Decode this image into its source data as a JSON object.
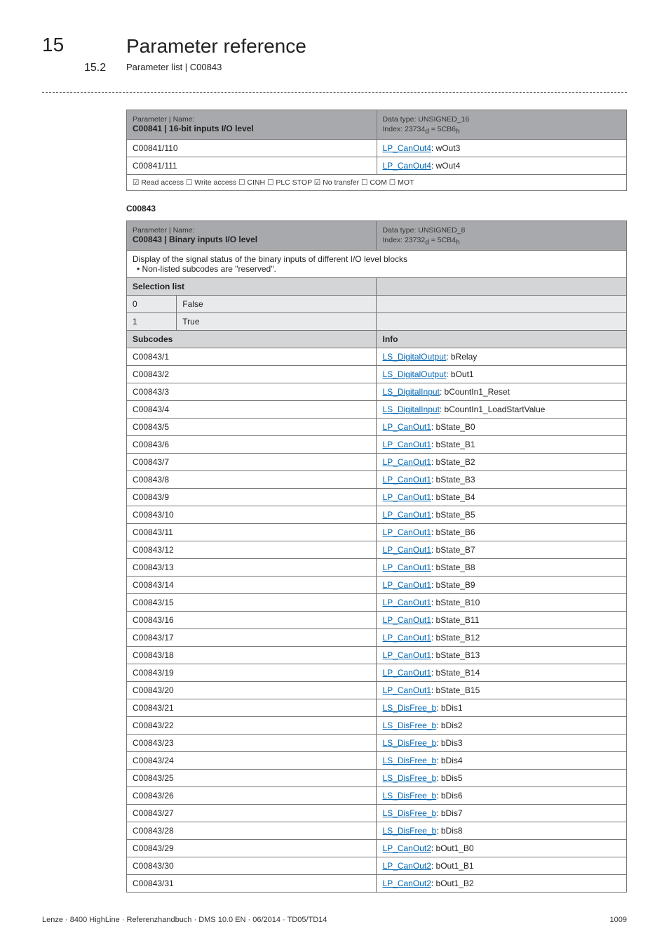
{
  "chapter": {
    "num": "15",
    "title": "Parameter reference"
  },
  "section": {
    "num": "15.2",
    "title": "Parameter list | C00843"
  },
  "table1": {
    "header_left": "Parameter | Name:",
    "header_code": "C00841 | 16-bit inputs I/O level",
    "header_right_l1": "Data type: UNSIGNED_16",
    "header_right_l2_a": "Index: 23734",
    "header_right_l2_sub": "d",
    "header_right_l2_b": " = 5CB6",
    "header_right_l2_sub2": "h",
    "rows": [
      {
        "code": "C00841/110",
        "link": "LP_CanOut4",
        "after": ": wOut3"
      },
      {
        "code": "C00841/111",
        "link": "LP_CanOut4",
        "after": ": wOut4"
      }
    ],
    "footer": "☑ Read access   ☐ Write access   ☐ CINH   ☐ PLC STOP   ☑ No transfer   ☐ COM   ☐ MOT"
  },
  "anchor": "C00843",
  "table2": {
    "header_left": "Parameter | Name:",
    "header_code": "C00843 | Binary inputs I/O level",
    "header_right_l1": "Data type: UNSIGNED_8",
    "header_right_l2_a": "Index: 23732",
    "header_right_l2_sub": "d",
    "header_right_l2_b": " = 5CB4",
    "header_right_l2_sub2": "h",
    "desc1": "Display of the signal status of the binary inputs of different I/O level blocks",
    "desc2": "• Non-listed subcodes are \"reserved\".",
    "selection_label": "Selection list",
    "sel_rows": [
      {
        "n": "0",
        "v": "False"
      },
      {
        "n": "1",
        "v": "True"
      }
    ],
    "subcodes_label": "Subcodes",
    "info_label": "Info",
    "rows": [
      {
        "code": "C00843/1",
        "link": "LS_DigitalOutput",
        "after": ": bRelay"
      },
      {
        "code": "C00843/2",
        "link": "LS_DigitalOutput",
        "after": ": bOut1"
      },
      {
        "code": "C00843/3",
        "link": "LS_DigitalInput",
        "after": ": bCountIn1_Reset"
      },
      {
        "code": "C00843/4",
        "link": "LS_DigitalInput",
        "after": ": bCountIn1_LoadStartValue"
      },
      {
        "code": "C00843/5",
        "link": "LP_CanOut1",
        "after": ": bState_B0"
      },
      {
        "code": "C00843/6",
        "link": "LP_CanOut1",
        "after": ": bState_B1"
      },
      {
        "code": "C00843/7",
        "link": "LP_CanOut1",
        "after": ": bState_B2"
      },
      {
        "code": "C00843/8",
        "link": "LP_CanOut1",
        "after": ": bState_B3"
      },
      {
        "code": "C00843/9",
        "link": "LP_CanOut1",
        "after": ": bState_B4"
      },
      {
        "code": "C00843/10",
        "link": "LP_CanOut1",
        "after": ": bState_B5"
      },
      {
        "code": "C00843/11",
        "link": "LP_CanOut1",
        "after": ": bState_B6"
      },
      {
        "code": "C00843/12",
        "link": "LP_CanOut1",
        "after": ": bState_B7"
      },
      {
        "code": "C00843/13",
        "link": "LP_CanOut1",
        "after": ": bState_B8"
      },
      {
        "code": "C00843/14",
        "link": "LP_CanOut1",
        "after": ": bState_B9"
      },
      {
        "code": "C00843/15",
        "link": "LP_CanOut1",
        "after": ": bState_B10"
      },
      {
        "code": "C00843/16",
        "link": "LP_CanOut1",
        "after": ": bState_B11"
      },
      {
        "code": "C00843/17",
        "link": "LP_CanOut1",
        "after": ": bState_B12"
      },
      {
        "code": "C00843/18",
        "link": "LP_CanOut1",
        "after": ": bState_B13"
      },
      {
        "code": "C00843/19",
        "link": "LP_CanOut1",
        "after": ": bState_B14"
      },
      {
        "code": "C00843/20",
        "link": "LP_CanOut1",
        "after": ": bState_B15"
      },
      {
        "code": "C00843/21",
        "link": "LS_DisFree_b",
        "after": ": bDis1"
      },
      {
        "code": "C00843/22",
        "link": "LS_DisFree_b",
        "after": ": bDis2"
      },
      {
        "code": "C00843/23",
        "link": "LS_DisFree_b",
        "after": ": bDis3"
      },
      {
        "code": "C00843/24",
        "link": "LS_DisFree_b",
        "after": ": bDis4"
      },
      {
        "code": "C00843/25",
        "link": "LS_DisFree_b",
        "after": ": bDis5"
      },
      {
        "code": "C00843/26",
        "link": "LS_DisFree_b",
        "after": ": bDis6"
      },
      {
        "code": "C00843/27",
        "link": "LS_DisFree_b",
        "after": ": bDis7"
      },
      {
        "code": "C00843/28",
        "link": "LS_DisFree_b",
        "after": ": bDis8"
      },
      {
        "code": "C00843/29",
        "link": "LP_CanOut2",
        "after": ": bOut1_B0"
      },
      {
        "code": "C00843/30",
        "link": "LP_CanOut2",
        "after": ": bOut1_B1"
      },
      {
        "code": "C00843/31",
        "link": "LP_CanOut2",
        "after": ": bOut1_B2"
      }
    ]
  },
  "footer": {
    "left": "Lenze · 8400 HighLine · Referenzhandbuch · DMS 10.0 EN · 06/2014 · TD05/TD14",
    "right": "1009"
  }
}
